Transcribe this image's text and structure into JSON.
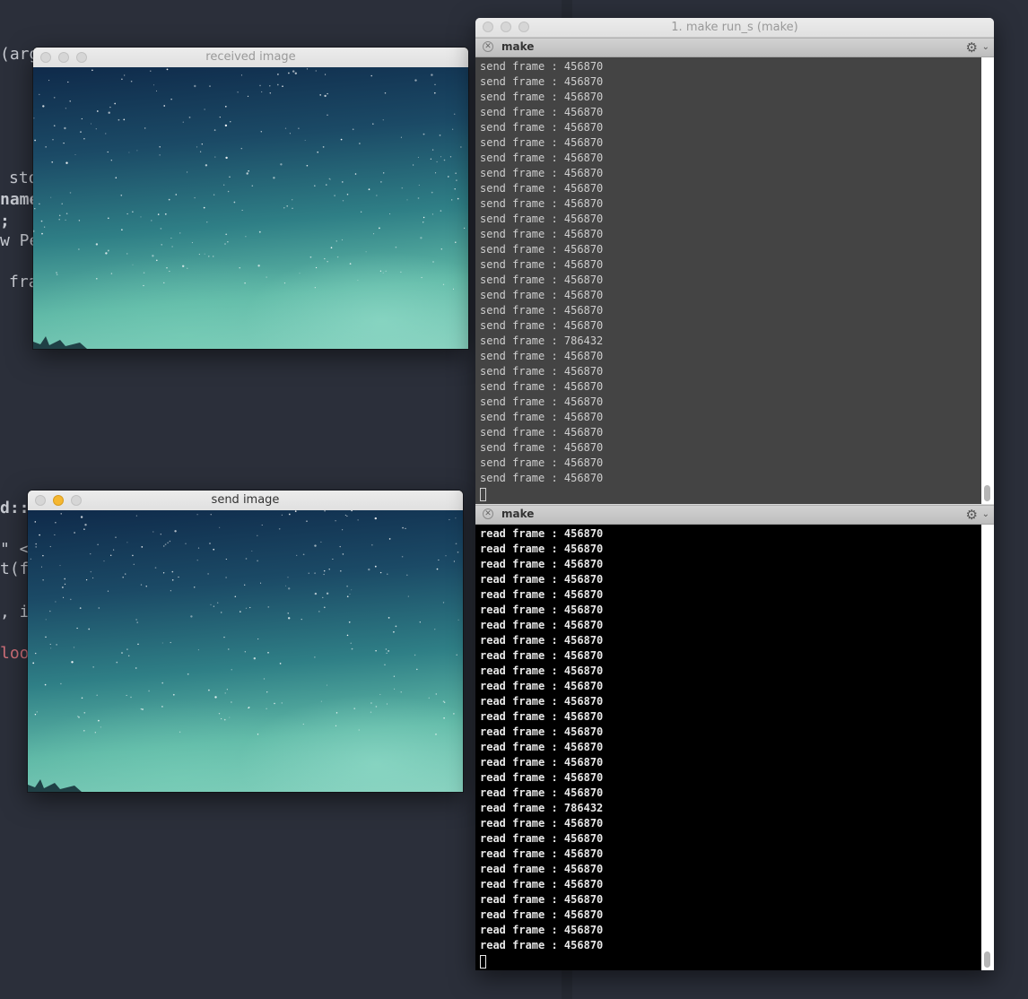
{
  "editor": {
    "fragments": [
      "(arg",
      "sto",
      "name",
      ";",
      "w Pe",
      "fra",
      "d::",
      "\" <",
      "t(f.",
      ", i",
      "loo"
    ]
  },
  "received_window": {
    "title": "received image"
  },
  "send_window": {
    "title": "send image"
  },
  "terminal": {
    "title": "1. make run_s (make)",
    "top_pane": {
      "name": "make",
      "lines": [
        "send frame : 456870",
        "send frame : 456870",
        "send frame : 456870",
        "send frame : 456870",
        "send frame : 456870",
        "send frame : 456870",
        "send frame : 456870",
        "send frame : 456870",
        "send frame : 456870",
        "send frame : 456870",
        "send frame : 456870",
        "send frame : 456870",
        "send frame : 456870",
        "send frame : 456870",
        "send frame : 456870",
        "send frame : 456870",
        "send frame : 456870",
        "send frame : 456870",
        "send frame : 786432",
        "send frame : 456870",
        "send frame : 456870",
        "send frame : 456870",
        "send frame : 456870",
        "send frame : 456870",
        "send frame : 456870",
        "send frame : 456870",
        "send frame : 456870",
        "send frame : 456870"
      ]
    },
    "bottom_pane": {
      "name": "make",
      "lines": [
        "read frame : 456870",
        "read frame : 456870",
        "read frame : 456870",
        "read frame : 456870",
        "read frame : 456870",
        "read frame : 456870",
        "read frame : 456870",
        "read frame : 456870",
        "read frame : 456870",
        "read frame : 456870",
        "read frame : 456870",
        "read frame : 456870",
        "read frame : 456870",
        "read frame : 456870",
        "read frame : 456870",
        "read frame : 456870",
        "read frame : 456870",
        "read frame : 456870",
        "read frame : 786432",
        "read frame : 456870",
        "read frame : 456870",
        "read frame : 456870",
        "read frame : 456870",
        "read frame : 456870",
        "read frame : 456870",
        "read frame : 456870",
        "read frame : 456870",
        "read frame : 456870"
      ]
    }
  },
  "icons": {
    "close": "close-icon",
    "gear": "gear-icon",
    "chevron": "chevron-down-icon"
  },
  "colors": {
    "editor_bg": "#2b2f3a",
    "top_pane_bg": "#444444",
    "bottom_pane_bg": "#000000",
    "minimize_yellow": "#f5b731"
  }
}
